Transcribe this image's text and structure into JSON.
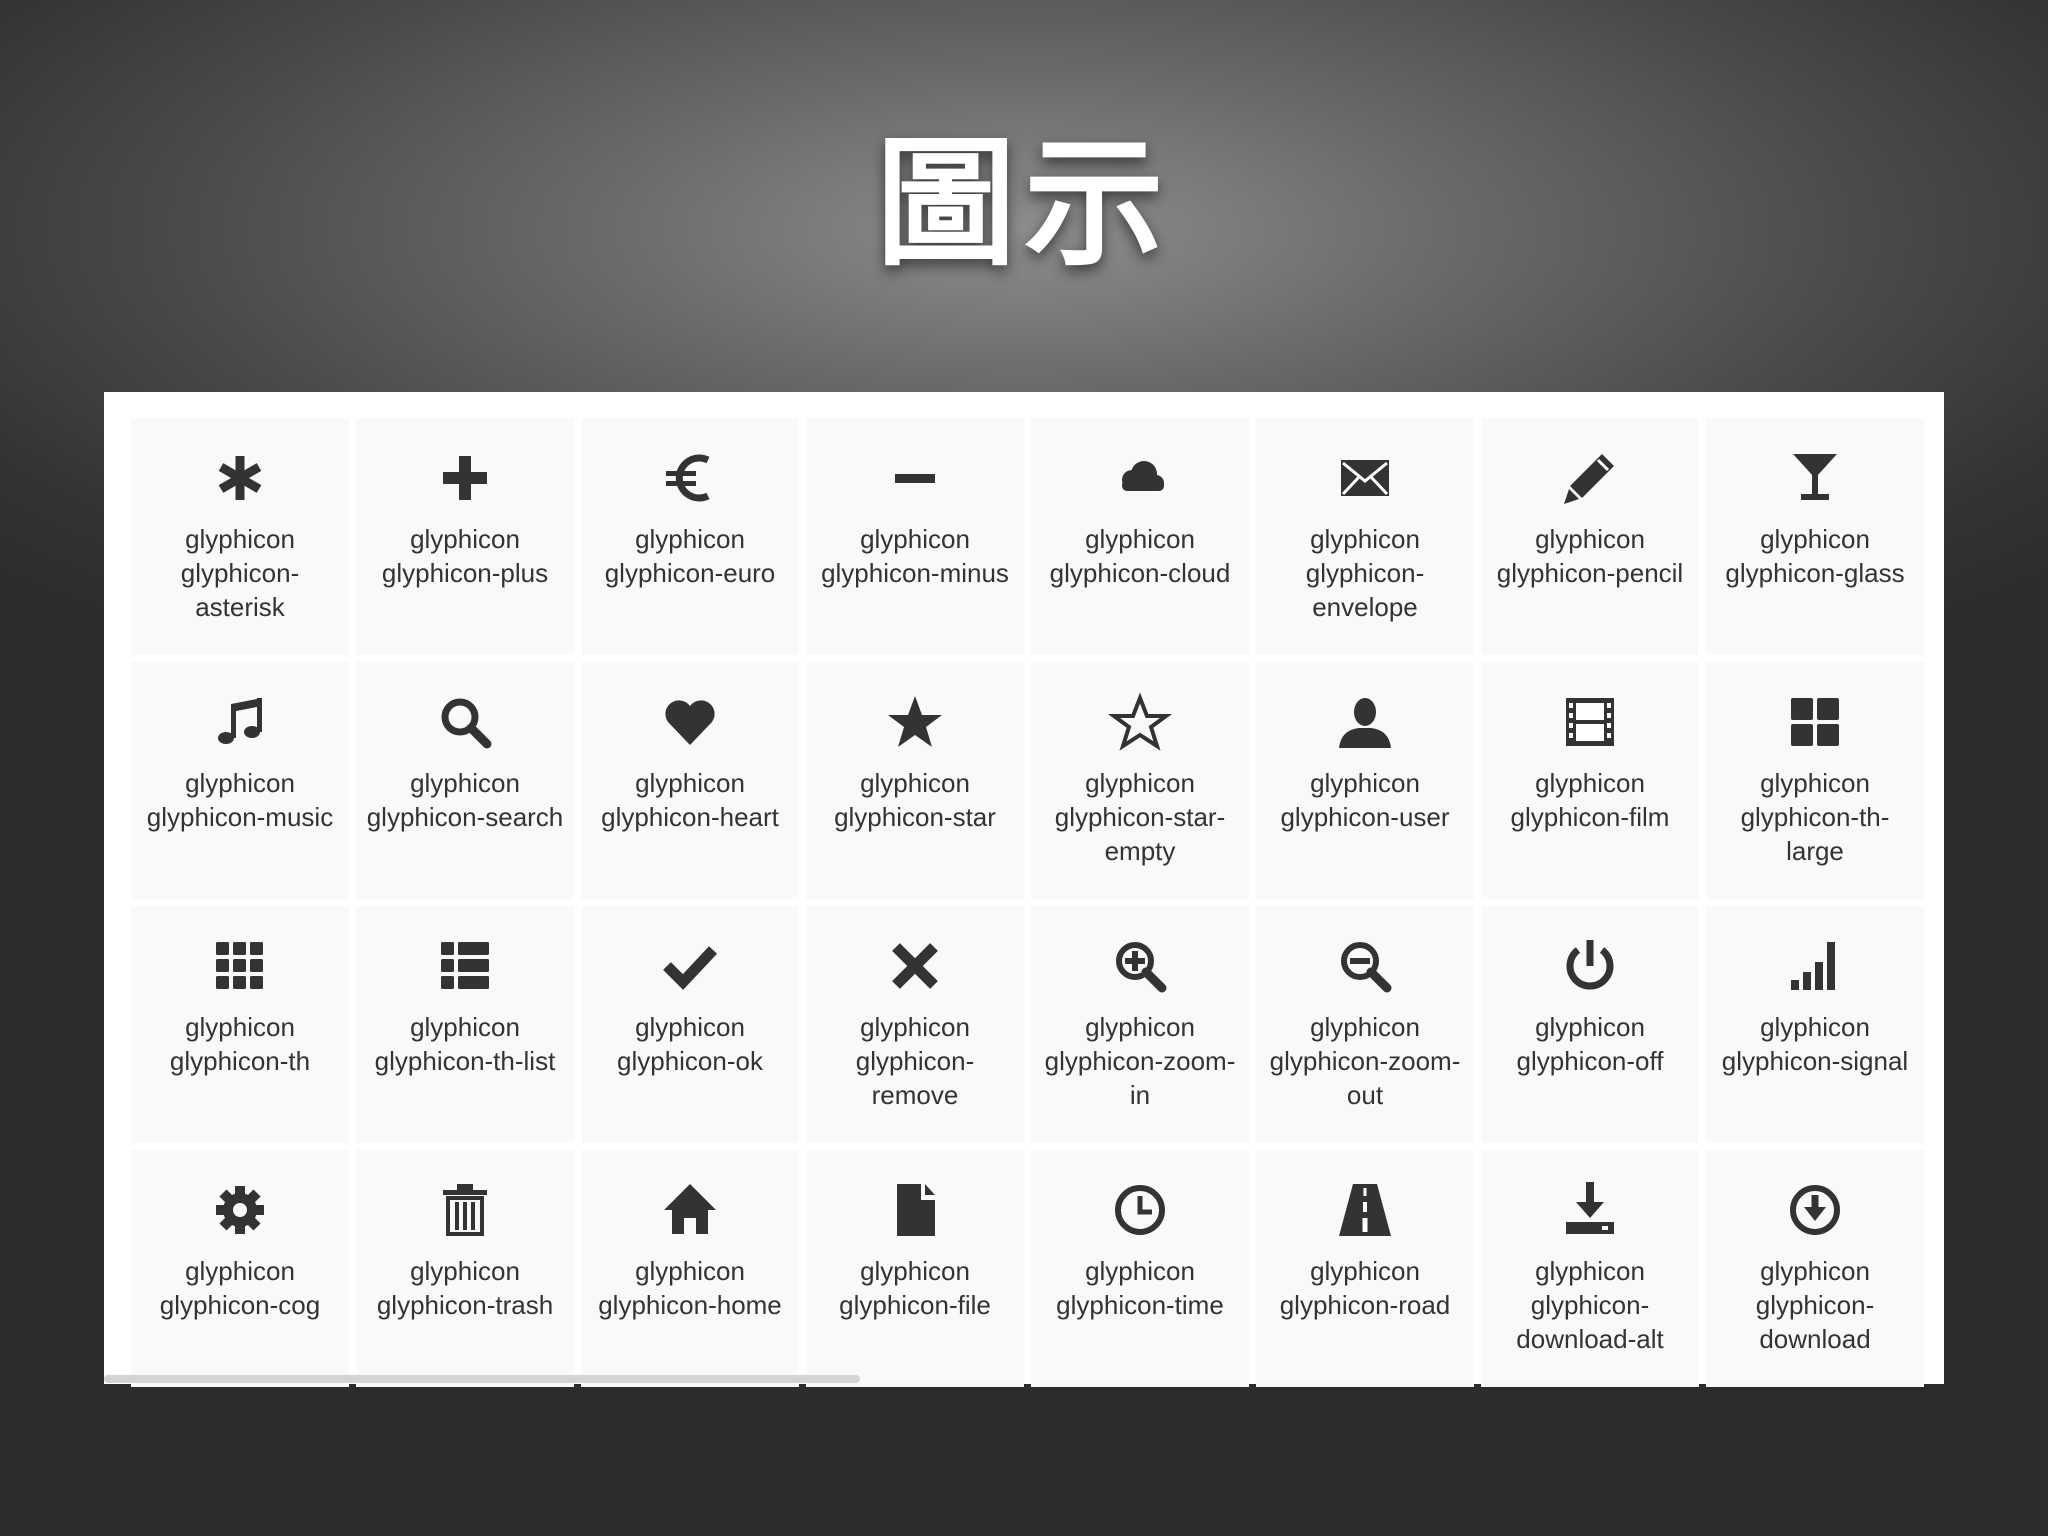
{
  "slide": {
    "title": "圖示"
  },
  "colors": {
    "icon": "#333333",
    "cell_background": "#f9f9f9",
    "panel_background": "#ffffff"
  },
  "icons": [
    {
      "icon": "asterisk-icon",
      "label": "glyphicon glyphicon-asterisk"
    },
    {
      "icon": "plus-icon",
      "label": "glyphicon glyphicon-plus"
    },
    {
      "icon": "euro-icon",
      "label": "glyphicon glyphicon-euro"
    },
    {
      "icon": "minus-icon",
      "label": "glyphicon glyphicon-minus"
    },
    {
      "icon": "cloud-icon",
      "label": "glyphicon glyphicon-cloud"
    },
    {
      "icon": "envelope-icon",
      "label": "glyphicon glyphicon-envelope"
    },
    {
      "icon": "pencil-icon",
      "label": "glyphicon glyphicon-pencil"
    },
    {
      "icon": "glass-icon",
      "label": "glyphicon glyphicon-glass"
    },
    {
      "icon": "music-icon",
      "label": "glyphicon glyphicon-music"
    },
    {
      "icon": "search-icon",
      "label": "glyphicon glyphicon-search"
    },
    {
      "icon": "heart-icon",
      "label": "glyphicon glyphicon-heart"
    },
    {
      "icon": "star-icon",
      "label": "glyphicon glyphicon-star"
    },
    {
      "icon": "star-empty-icon",
      "label": "glyphicon glyphicon-star-empty"
    },
    {
      "icon": "user-icon",
      "label": "glyphicon glyphicon-user"
    },
    {
      "icon": "film-icon",
      "label": "glyphicon glyphicon-film"
    },
    {
      "icon": "th-large-icon",
      "label": "glyphicon glyphicon-th-large"
    },
    {
      "icon": "th-icon",
      "label": "glyphicon glyphicon-th"
    },
    {
      "icon": "th-list-icon",
      "label": "glyphicon glyphicon-th-list"
    },
    {
      "icon": "ok-icon",
      "label": "glyphicon glyphicon-ok"
    },
    {
      "icon": "remove-icon",
      "label": "glyphicon glyphicon-remove"
    },
    {
      "icon": "zoom-in-icon",
      "label": "glyphicon glyphicon-zoom-in"
    },
    {
      "icon": "zoom-out-icon",
      "label": "glyphicon glyphicon-zoom-out"
    },
    {
      "icon": "off-icon",
      "label": "glyphicon glyphicon-off"
    },
    {
      "icon": "signal-icon",
      "label": "glyphicon glyphicon-signal"
    },
    {
      "icon": "cog-icon",
      "label": "glyphicon glyphicon-cog"
    },
    {
      "icon": "trash-icon",
      "label": "glyphicon glyphicon-trash"
    },
    {
      "icon": "home-icon",
      "label": "glyphicon glyphicon-home"
    },
    {
      "icon": "file-icon",
      "label": "glyphicon glyphicon-file"
    },
    {
      "icon": "time-icon",
      "label": "glyphicon glyphicon-time"
    },
    {
      "icon": "road-icon",
      "label": "glyphicon glyphicon-road"
    },
    {
      "icon": "download-alt-icon",
      "label": "glyphicon glyphicon-download-alt"
    },
    {
      "icon": "download-icon",
      "label": "glyphicon glyphicon-download"
    }
  ]
}
